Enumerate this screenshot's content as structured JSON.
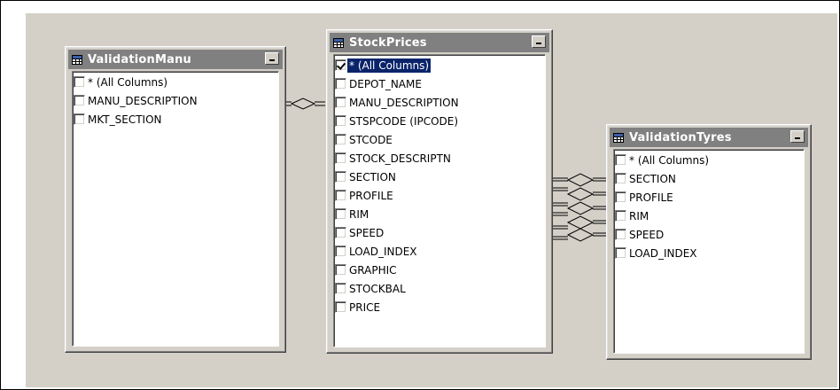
{
  "tables": [
    {
      "id": "validation-manu",
      "title": "ValidationManu",
      "columns": [
        {
          "label": "* (All Columns)",
          "checked": false,
          "selected": false
        },
        {
          "label": "MANU_DESCRIPTION",
          "checked": false,
          "selected": false
        },
        {
          "label": "MKT_SECTION",
          "checked": false,
          "selected": false
        }
      ]
    },
    {
      "id": "stock-prices",
      "title": "StockPrices",
      "columns": [
        {
          "label": "* (All Columns)",
          "checked": true,
          "selected": true
        },
        {
          "label": "DEPOT_NAME",
          "checked": false,
          "selected": false
        },
        {
          "label": "MANU_DESCRIPTION",
          "checked": false,
          "selected": false
        },
        {
          "label": "STSPCODE (IPCODE)",
          "checked": false,
          "selected": false
        },
        {
          "label": "STCODE",
          "checked": false,
          "selected": false
        },
        {
          "label": "STOCK_DESCRIPTN",
          "checked": false,
          "selected": false
        },
        {
          "label": "SECTION",
          "checked": false,
          "selected": false
        },
        {
          "label": "PROFILE",
          "checked": false,
          "selected": false
        },
        {
          "label": "RIM",
          "checked": false,
          "selected": false
        },
        {
          "label": "SPEED",
          "checked": false,
          "selected": false
        },
        {
          "label": "LOAD_INDEX",
          "checked": false,
          "selected": false
        },
        {
          "label": "GRAPHIC",
          "checked": false,
          "selected": false
        },
        {
          "label": "STOCKBAL",
          "checked": false,
          "selected": false
        },
        {
          "label": "PRICE",
          "checked": false,
          "selected": false
        }
      ]
    },
    {
      "id": "validation-tyres",
      "title": "ValidationTyres",
      "columns": [
        {
          "label": "* (All Columns)",
          "checked": false,
          "selected": false
        },
        {
          "label": "SECTION",
          "checked": false,
          "selected": false
        },
        {
          "label": "PROFILE",
          "checked": false,
          "selected": false
        },
        {
          "label": "RIM",
          "checked": false,
          "selected": false
        },
        {
          "label": "SPEED",
          "checked": false,
          "selected": false
        },
        {
          "label": "LOAD_INDEX",
          "checked": false,
          "selected": false
        }
      ]
    }
  ],
  "icons": {
    "table": "table-grid-icon",
    "minimize": "minimize-icon",
    "checkbox": "checkmark-icon"
  },
  "colors": {
    "canvas": "#d4d0c8",
    "titlebar": "#808080",
    "selection": "#0a246a"
  }
}
